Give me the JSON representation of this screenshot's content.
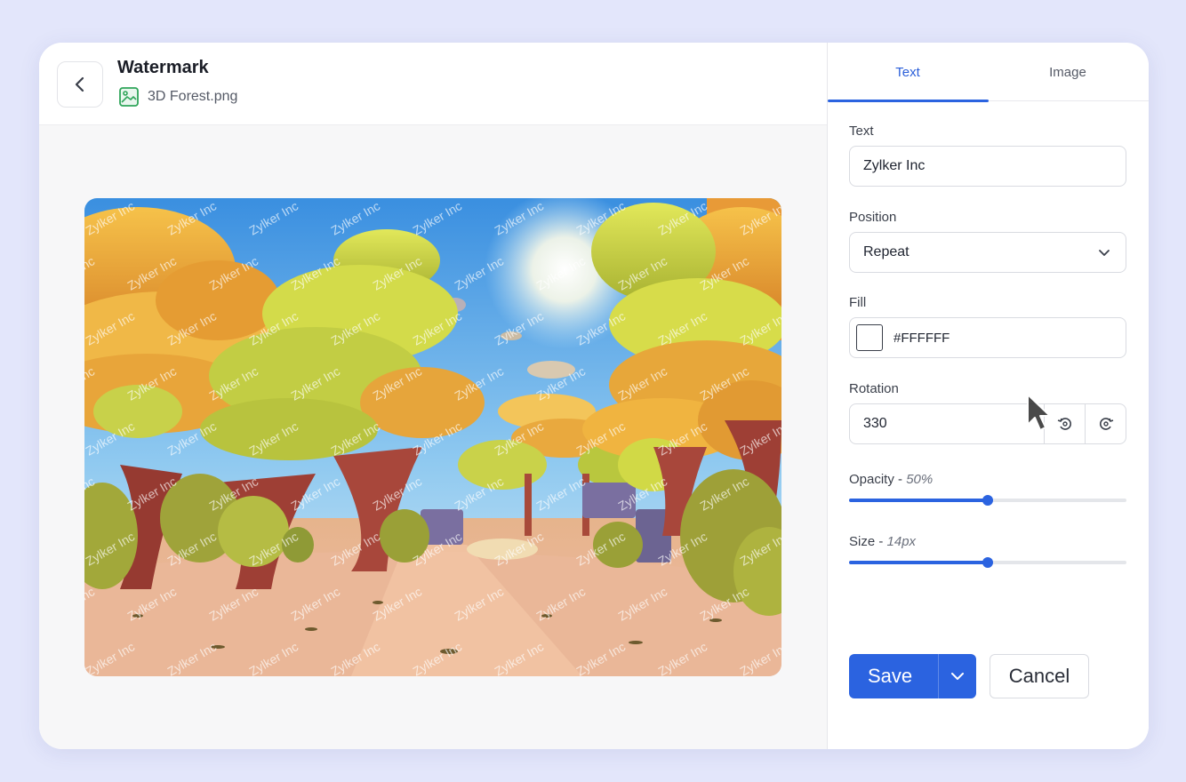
{
  "header": {
    "title": "Watermark",
    "file_name": "3D Forest.png",
    "back_icon": "chevron-left-icon",
    "file_icon": "image-file-icon"
  },
  "preview": {
    "watermark_text": "Zylker Inc",
    "scene": "3D cartoon forest path"
  },
  "tabs": [
    {
      "label": "Text",
      "active": true
    },
    {
      "label": "Image",
      "active": false
    }
  ],
  "form": {
    "text_label": "Text",
    "text_value": "Zylker Inc",
    "position_label": "Position",
    "position_value": "Repeat",
    "fill_label": "Fill",
    "fill_value": "#FFFFFF",
    "rotation_label": "Rotation",
    "rotation_value": "330",
    "opacity_label": "Opacity",
    "opacity_value_text": "50%",
    "opacity_fraction": 0.5,
    "size_label": "Size",
    "size_value_text": "14px",
    "size_fraction": 0.5
  },
  "actions": {
    "save_label": "Save",
    "cancel_label": "Cancel"
  },
  "colors": {
    "accent": "#2B63E0",
    "background": "#E3E6FB"
  }
}
